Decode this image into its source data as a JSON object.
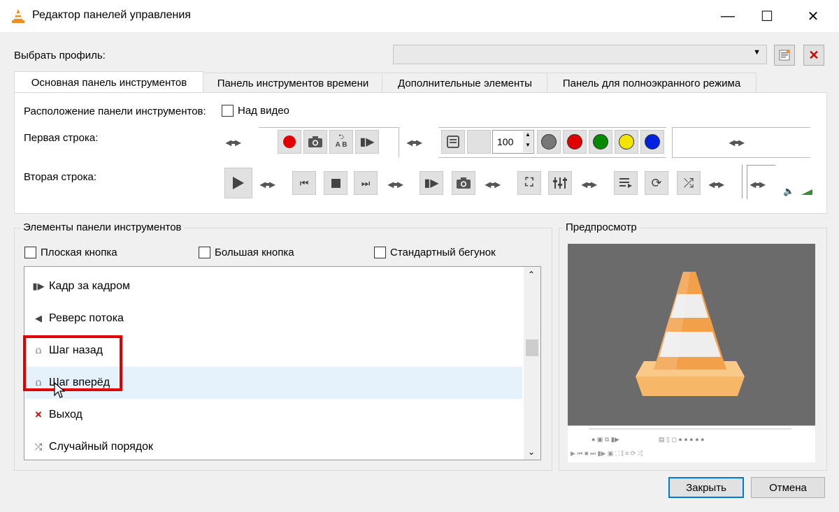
{
  "window": {
    "title": "Редактор панелей управления",
    "minimize_glyph": "—",
    "maximize_glyph": "☐",
    "close_glyph": "✕"
  },
  "profile": {
    "label": "Выбрать профиль:",
    "value": ""
  },
  "tabs": [
    {
      "label": "Основная панель инструментов",
      "active": true
    },
    {
      "label": "Панель инструментов времени",
      "active": false
    },
    {
      "label": "Дополнительные элементы",
      "active": false
    },
    {
      "label": "Панель для полноэкранного режима",
      "active": false
    }
  ],
  "toolbar_panel": {
    "position_label": "Расположение панели инструментов:",
    "above_video_label": "Над видео",
    "first_row_label": "Первая строка:",
    "second_row_label": "Вторая строка:",
    "volume_value": "100",
    "ab_label": "A B"
  },
  "elements_group": {
    "title": "Элементы панели инструментов",
    "flat_button_label": "Плоская кнопка",
    "big_button_label": "Большая кнопка",
    "standard_slider_label": "Стандартный бегунок",
    "items": [
      {
        "icon": "frame-by-frame-icon",
        "glyph": "▮▶",
        "label": "Кадр за кадром"
      },
      {
        "icon": "reverse-icon",
        "glyph": "◀",
        "label": "Реверс потока"
      },
      {
        "icon": "step-back-icon",
        "glyph": "⩍",
        "label": "Шаг назад"
      },
      {
        "icon": "step-forward-icon",
        "glyph": "⩍",
        "label": "Шаг вперёд"
      },
      {
        "icon": "quit-icon",
        "glyph": "✕",
        "label": "Выход"
      },
      {
        "icon": "shuffle-icon",
        "glyph": "⤮",
        "label": "Случайный порядок"
      }
    ]
  },
  "preview": {
    "title": "Предпросмотр"
  },
  "footer": {
    "close_label": "Закрыть",
    "cancel_label": "Отмена"
  },
  "colors": {
    "accent": "#0078d7",
    "highlight_box": "#e00000",
    "record": "#e00000",
    "selection": "#e5f1fb"
  }
}
